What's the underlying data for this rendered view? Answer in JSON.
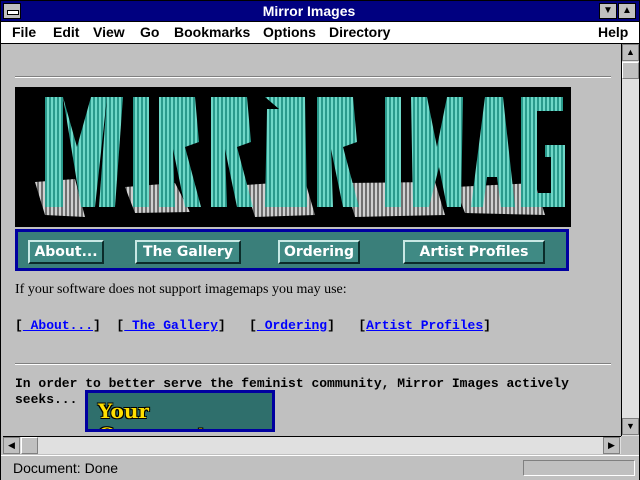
{
  "window": {
    "title": "Mirror Images"
  },
  "menu": {
    "file": "File",
    "edit": "Edit",
    "view": "View",
    "go": "Go",
    "bookmarks": "Bookmarks",
    "options": "Options",
    "directory": "Directory",
    "help": "Help"
  },
  "banner": {
    "text": "MIRROR IMAGES"
  },
  "imagemap": {
    "buttons": [
      "About...",
      "The Gallery",
      "Ordering",
      "Artist Profiles"
    ]
  },
  "page": {
    "imagemap_note": "If your software does not support imagemaps you may use:",
    "links": [
      " About...",
      " The Gallery",
      " Ordering",
      "Artist Profiles"
    ],
    "seek_text_line1": "In order to better serve the feminist community, Mirror Images actively",
    "seek_text_line2": "seeks...",
    "comments_image_text": "Your Comments"
  },
  "status": {
    "text": "Document: Done"
  },
  "colors": {
    "title_bar": "#000080",
    "link": "#0000ff",
    "teal": "#3f8a84",
    "banner_teal": "#48c0b0"
  }
}
